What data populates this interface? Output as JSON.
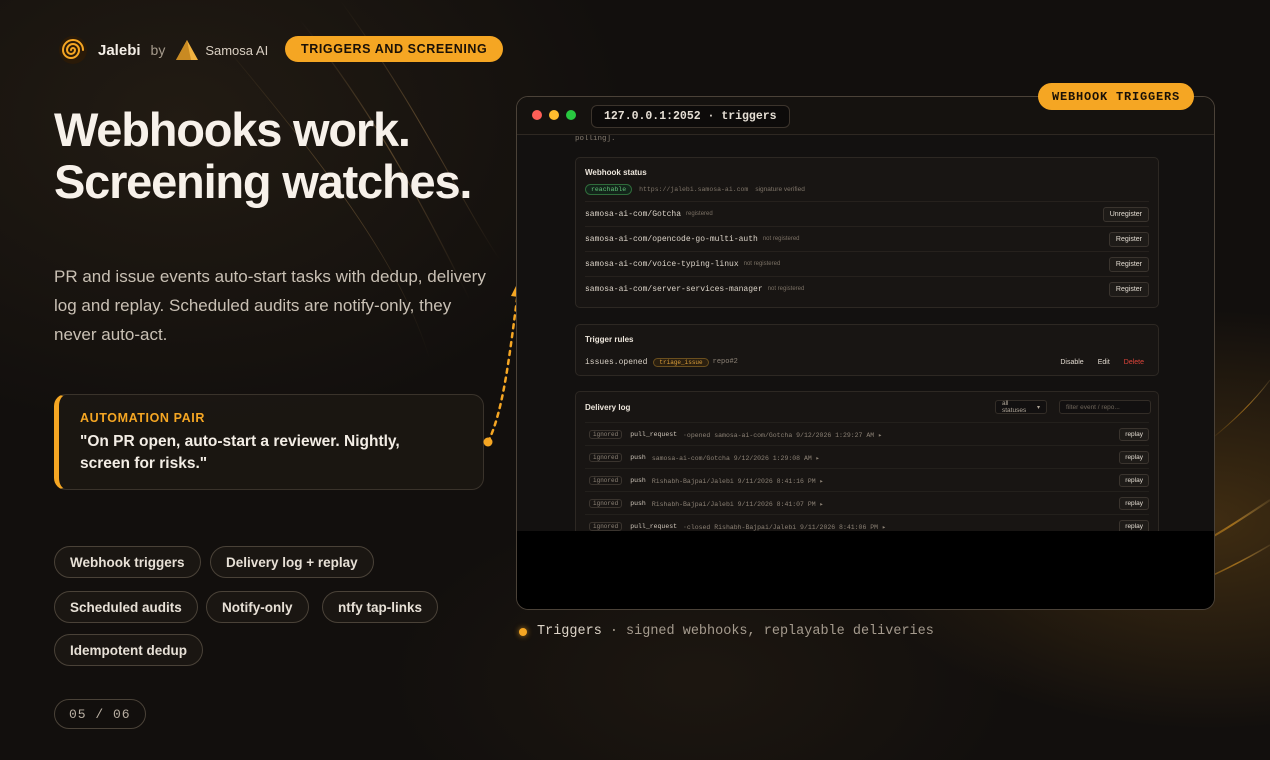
{
  "brand": {
    "name": "Jalebi",
    "by": "by",
    "partner": "Samosa AI"
  },
  "tag": "TRIGGERS AND SCREENING",
  "headline": {
    "line1": "Webhooks work.",
    "line2": "Screening watches."
  },
  "description": "PR and issue events auto-start tasks with dedup, delivery log and replay. Scheduled audits are notify-only, they never auto-act.",
  "quote": {
    "label": "AUTOMATION PAIR",
    "text": "\"On PR open, auto-start a reviewer. Nightly, screen for risks.\""
  },
  "chips": [
    "Webhook triggers",
    "Delivery log + replay",
    "Scheduled audits",
    "Notify-only",
    "ntfy tap-links",
    "Idempotent dedup"
  ],
  "counter": "05 / 06",
  "window": {
    "badge": "WEBHOOK TRIGGERS",
    "url": "127.0.0.1:2052 · triggers",
    "polling_text": "polling].",
    "webhook_status": {
      "title": "Webhook status",
      "status": "reachable",
      "endpoint": "https://jalebi.samosa-ai.com",
      "signature": "signature verified",
      "repos": [
        {
          "name": "samosa-ai-com/Gotcha",
          "note": "registered",
          "action": "Unregister"
        },
        {
          "name": "samosa-ai-com/opencode-go-multi-auth",
          "note": "not registered",
          "action": "Register"
        },
        {
          "name": "samosa-ai-com/voice-typing-linux",
          "note": "not registered",
          "action": "Register"
        },
        {
          "name": "samosa-ai-com/server-services-manager",
          "note": "not registered",
          "action": "Register"
        }
      ]
    },
    "trigger_rules": {
      "title": "Trigger rules",
      "rule": {
        "event": "issues.opened",
        "tag": "triage_issue",
        "target": "repo#2"
      },
      "actions": {
        "disable": "Disable",
        "edit": "Edit",
        "delete": "Delete"
      }
    },
    "delivery_log": {
      "title": "Delivery log",
      "status_filter": "all statuses",
      "search_placeholder": "filter event / repo...",
      "rows": [
        {
          "status": "ignored",
          "event": "pull_request",
          "detail": "·opened samosa-ai-com/Gotcha 9/12/2026 1:29:27 AM ▸",
          "action": "replay"
        },
        {
          "status": "ignored",
          "event": "push",
          "detail": "samosa-ai-com/Gotcha 9/12/2026 1:29:08 AM ▸",
          "action": "replay"
        },
        {
          "status": "ignored",
          "event": "push",
          "detail": "Rishabh-Bajpai/Jalebi 9/11/2026 8:41:16 PM ▸",
          "action": "replay"
        },
        {
          "status": "ignored",
          "event": "push",
          "detail": "Rishabh-Bajpai/Jalebi 9/11/2026 8:41:07 PM ▸",
          "action": "replay"
        },
        {
          "status": "ignored",
          "event": "pull_request",
          "detail": "·closed Rishabh-Bajpai/Jalebi 9/11/2026 8:41:06 PM ▸",
          "action": "replay"
        }
      ]
    }
  },
  "caption": {
    "strong": "Triggers",
    "rest": "· signed webhooks, replayable deliveries"
  },
  "colors": {
    "accent": "#f5a623",
    "background": "#120f0d",
    "danger": "#e0443a",
    "success": "#62c077"
  },
  "icons": [
    "jalebi-spiral-icon",
    "samosa-triangle-icon",
    "window-close-dot-icon",
    "window-minimize-dot-icon",
    "window-maximize-dot-icon",
    "dotted-arrow-icon",
    "bullet-dot-icon",
    "chevron-down-icon"
  ]
}
